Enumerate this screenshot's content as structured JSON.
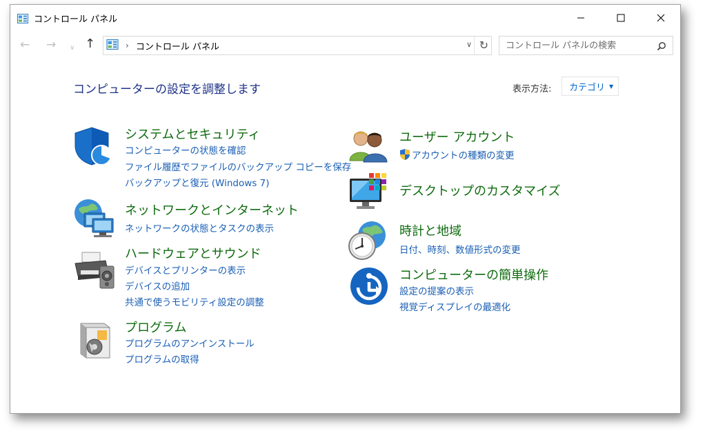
{
  "window": {
    "title": "コントロール パネル"
  },
  "nav": {
    "address_text": "コントロール パネル",
    "search_placeholder": "コントロール パネルの検索"
  },
  "content": {
    "heading": "コンピューターの設定を調整します",
    "view_by_label": "表示方法:",
    "view_by_value": "カテゴリ"
  },
  "categories": [
    {
      "title": "システムとセキュリティ",
      "icon": "shield-icon",
      "links": [
        "コンピューターの状態を確認",
        "ファイル履歴でファイルのバックアップ コピーを保存",
        "バックアップと復元 (Windows 7)"
      ]
    },
    {
      "title": "ネットワークとインターネット",
      "icon": "network-icon",
      "links": [
        "ネットワークの状態とタスクの表示"
      ]
    },
    {
      "title": "ハードウェアとサウンド",
      "icon": "printer-icon",
      "links": [
        "デバイスとプリンターの表示",
        "デバイスの追加",
        "共通で使うモビリティ設定の調整"
      ]
    },
    {
      "title": "プログラム",
      "icon": "programs-icon",
      "links": [
        "プログラムのアンインストール",
        "プログラムの取得"
      ]
    },
    {
      "title": "ユーザー アカウント",
      "icon": "users-icon",
      "links": [
        "アカウントの種類の変更"
      ]
    },
    {
      "title": "デスクトップのカスタマイズ",
      "icon": "desktop-icon",
      "links": []
    },
    {
      "title": "時計と地域",
      "icon": "clock-globe-icon",
      "links": [
        "日付、時刻、数値形式の変更"
      ]
    },
    {
      "title": "コンピューターの簡単操作",
      "icon": "ease-of-access-icon",
      "links": [
        "設定の提案の表示",
        "視覚ディスプレイの最適化"
      ]
    }
  ],
  "colors": {
    "heading": "#1e3287",
    "category_title": "#0e6b0e",
    "link": "#1a5fb4"
  }
}
